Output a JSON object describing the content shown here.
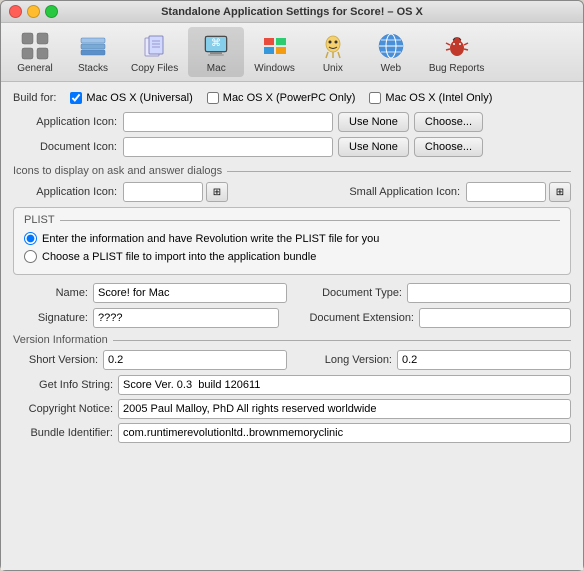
{
  "window": {
    "title": "Standalone Application Settings for Score! – OS X"
  },
  "toolbar": {
    "items": [
      {
        "id": "general",
        "label": "General",
        "icon": "⚙️",
        "active": false
      },
      {
        "id": "stacks",
        "label": "Stacks",
        "icon": "📚",
        "active": false
      },
      {
        "id": "copy-files",
        "label": "Copy Files",
        "icon": "📋",
        "active": false
      },
      {
        "id": "mac",
        "label": "Mac",
        "icon": "💻",
        "active": true
      },
      {
        "id": "windows",
        "label": "Windows",
        "icon": "🪟",
        "active": false
      },
      {
        "id": "unix",
        "label": "Unix",
        "icon": "🐧",
        "active": false
      },
      {
        "id": "web",
        "label": "Web",
        "icon": "🌐",
        "active": false
      },
      {
        "id": "bug-reports",
        "label": "Bug Reports",
        "icon": "🐛",
        "active": false
      }
    ]
  },
  "build_for": {
    "label": "Build for:",
    "options": [
      {
        "id": "universal",
        "label": "Mac OS X (Universal)",
        "checked": true
      },
      {
        "id": "powerpc",
        "label": "Mac OS X (PowerPC Only)",
        "checked": false
      },
      {
        "id": "intel",
        "label": "Mac OS X (Intel Only)",
        "checked": false
      }
    ]
  },
  "app_icon": {
    "label": "Application Icon:",
    "value": "",
    "use_none": "Use None",
    "choose": "Choose..."
  },
  "doc_icon": {
    "label": "Document Icon:",
    "value": "",
    "use_none": "Use None",
    "choose": "Choose..."
  },
  "ask_section": {
    "header": "Icons to display on ask and answer dialogs"
  },
  "ask_app_icon": {
    "label": "Application Icon:",
    "value": ""
  },
  "ask_small_icon": {
    "label": "Small Application Icon:",
    "value": ""
  },
  "plist": {
    "header": "PLIST",
    "radio1": "Enter the information and have Revolution write the PLIST file for you",
    "radio2": "Choose a PLIST file to import into the application bundle"
  },
  "name_field": {
    "label": "Name:",
    "value": "Score! for Mac"
  },
  "doc_type": {
    "label": "Document Type:",
    "value": ""
  },
  "signature": {
    "label": "Signature:",
    "value": "????"
  },
  "doc_ext": {
    "label": "Document Extension:",
    "value": ""
  },
  "version_section": {
    "header": "Version Information"
  },
  "short_version": {
    "label": "Short Version:",
    "value": "0.2"
  },
  "long_version": {
    "label": "Long Version:",
    "value": "0.2"
  },
  "get_info": {
    "label": "Get Info String:",
    "value": "Score Ver. 0.3  build 120611"
  },
  "copyright": {
    "label": "Copyright Notice:",
    "value": "2005 Paul Malloy, PhD All rights reserved worldwide"
  },
  "bundle_id": {
    "label": "Bundle Identifier:",
    "value": "com.runtimerevolutionltd..brownmemoryclinic"
  }
}
